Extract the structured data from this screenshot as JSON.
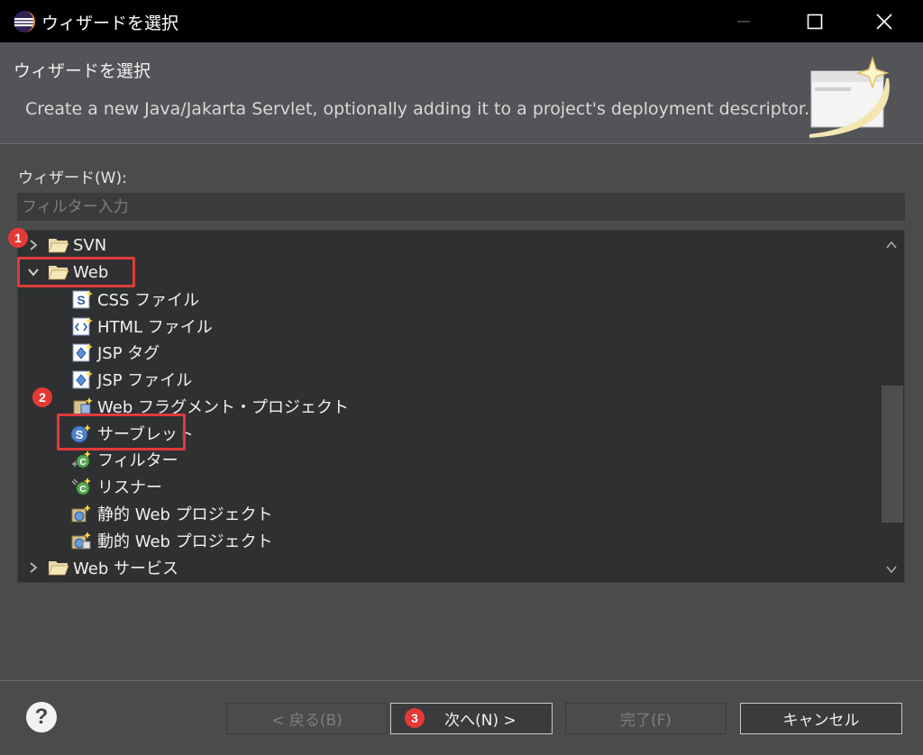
{
  "window": {
    "title": "ウィザードを選択"
  },
  "header": {
    "title": "ウィザードを選択",
    "description": "Create a new Java/Jakarta Servlet, optionally adding it to a project's deployment descriptor."
  },
  "wizard_label": "ウィザード(W):",
  "filter": {
    "placeholder": "フィルター入力",
    "value": ""
  },
  "tree": {
    "items": [
      {
        "label": "SVN"
      },
      {
        "label": "Web"
      },
      {
        "label": "CSS ファイル"
      },
      {
        "label": "HTML ファイル"
      },
      {
        "label": "JSP タグ"
      },
      {
        "label": "JSP ファイル"
      },
      {
        "label": "Web フラグメント・プロジェクト"
      },
      {
        "label": "サーブレット"
      },
      {
        "label": "フィルター"
      },
      {
        "label": "リスナー"
      },
      {
        "label": "静的 Web プロジェクト"
      },
      {
        "label": "動的 Web プロジェクト"
      },
      {
        "label": "Web サービス"
      }
    ]
  },
  "badges": [
    "1",
    "2",
    "3"
  ],
  "buttons": {
    "back": "< 戻る(B)",
    "next": "次へ(N) >",
    "finish": "完了(F)",
    "cancel": "キャンセル"
  },
  "help_glyph": "?",
  "colors": {
    "highlight": "#e03a3a",
    "badge": "#e53935",
    "accent_blue": "#3a6fc2"
  }
}
